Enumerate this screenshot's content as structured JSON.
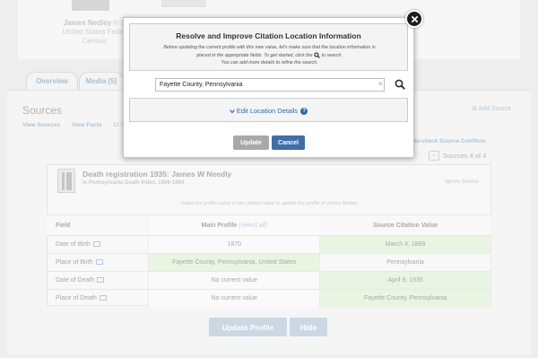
{
  "background": {
    "person": {
      "name": "James Nedley",
      "name_suffix": "in 1",
      "line2": "United States Feder",
      "line3": "Census"
    },
    "tabs": [
      {
        "label": "Overview"
      },
      {
        "label": "Media (5)"
      }
    ],
    "sources": {
      "title": "Sources",
      "view_sources": "View Sources",
      "view_facts": "View Facts",
      "count_fragment": "12 S",
      "add_source": "Add Source",
      "recheck": "ta-check Source Conflicts",
      "sources_of": "Sources 4 of 4",
      "prev_arrow": "‹"
    },
    "record": {
      "title": "Death registration 1935: James W Needly",
      "subtitle": "In Pennsylvania Death Index, 1906-1964",
      "ignore": "Ignore Source",
      "hint": "Select the profile value or the citation value to update the profile of James Nedley"
    },
    "table": {
      "headers": {
        "field": "Field",
        "main": "Main Profile",
        "select_all": "(select all)",
        "source": "Source Citation Value"
      },
      "rows": [
        {
          "field": "Date of Birth",
          "main": "1870",
          "source": "March 4, 1869"
        },
        {
          "field": "Place of Birth",
          "main": "Fayette County, Pennsylvania, United States",
          "source": "Pennsylvania"
        },
        {
          "field": "Date of Death",
          "main": "No current value",
          "source": "April 9, 1935"
        },
        {
          "field": "Place of Death",
          "main": "No current value",
          "source": "Fayette County, Pennsylvania"
        }
      ]
    },
    "buttons": {
      "update_profile": "Update Profile",
      "hide": "Hide"
    }
  },
  "modal": {
    "title": "Resolve and Improve Citation Location Information",
    "desc_line1": "Before updating the current profile with this new value, let's make sure that the location information is",
    "desc_line2a": "placed in the appropriate fields. To get started, click the",
    "desc_line2b": "to search.",
    "desc_line3": "You can add more details to refine the search.",
    "location_value": "Fayette County, Pennsylvania",
    "clear_glyph": "×",
    "edit_details": "Edit Location Details",
    "info_glyph": "?",
    "update_label": "Update",
    "cancel_label": "Cancel",
    "close_glyph": "×"
  },
  "colors": {
    "accent": "#3f6fa8",
    "link": "#2d6aa8",
    "highlight_green": "#e6f3df",
    "disabled_button": "#a8a8a8"
  },
  "icons": [
    "search-icon",
    "close-icon",
    "clear-icon",
    "info-icon",
    "chevron-down-icon",
    "record-icon",
    "list-icon",
    "plus-icon"
  ]
}
